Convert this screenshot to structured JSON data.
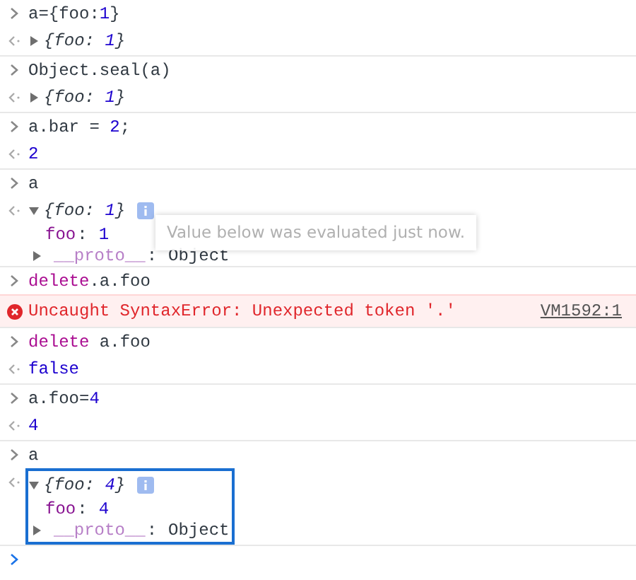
{
  "entries": [
    {
      "input": [
        {
          "text": "a={foo:",
          "kind": "plain"
        },
        {
          "text": "1",
          "kind": "number"
        },
        {
          "text": "}",
          "kind": "plain"
        }
      ],
      "output": {
        "kind": "object",
        "expanded": false,
        "info": false,
        "highlighted": false,
        "preview": [
          {
            "text": "{foo: ",
            "kind": "plain"
          },
          {
            "text": "1",
            "kind": "number"
          },
          {
            "text": "}",
            "kind": "plain"
          }
        ]
      }
    },
    {
      "input": [
        {
          "text": "Object.seal(a)",
          "kind": "plain"
        }
      ],
      "output": {
        "kind": "object",
        "expanded": false,
        "info": false,
        "highlighted": false,
        "preview": [
          {
            "text": "{foo: ",
            "kind": "plain"
          },
          {
            "text": "1",
            "kind": "number"
          },
          {
            "text": "}",
            "kind": "plain"
          }
        ]
      }
    },
    {
      "input": [
        {
          "text": "a.bar = ",
          "kind": "plain"
        },
        {
          "text": "2",
          "kind": "number"
        },
        {
          "text": ";",
          "kind": "plain"
        }
      ],
      "output": {
        "kind": "value",
        "text": "2"
      }
    },
    {
      "input": [
        {
          "text": "a",
          "kind": "plain"
        }
      ],
      "output": {
        "kind": "object",
        "expanded": true,
        "info": true,
        "highlighted": false,
        "tooltip": "Value below was evaluated just now.",
        "preview": [
          {
            "text": "{foo: ",
            "kind": "plain"
          },
          {
            "text": "1",
            "kind": "number"
          },
          {
            "text": "}",
            "kind": "plain"
          }
        ],
        "children": [
          {
            "key": "foo",
            "separator": ":",
            "value": "1",
            "kind": "own"
          },
          {
            "key": "__proto__",
            "separator": ":",
            "value": "Object",
            "kind": "inherited"
          }
        ]
      }
    },
    {
      "input": [
        {
          "text": "delete",
          "kind": "keyword"
        },
        {
          "text": ".a.foo",
          "kind": "plain"
        }
      ],
      "output": {
        "kind": "error",
        "text": "Uncaught SyntaxError: Unexpected token '.'",
        "source": "VM1592:1"
      }
    },
    {
      "input": [
        {
          "text": "delete",
          "kind": "keyword"
        },
        {
          "text": " a.foo",
          "kind": "plain"
        }
      ],
      "output": {
        "kind": "value",
        "text": "false"
      }
    },
    {
      "input": [
        {
          "text": "a.foo=",
          "kind": "plain"
        },
        {
          "text": "4",
          "kind": "number"
        }
      ],
      "output": {
        "kind": "value",
        "text": "4"
      }
    },
    {
      "input": [
        {
          "text": "a",
          "kind": "plain"
        }
      ],
      "output": {
        "kind": "object",
        "expanded": true,
        "info": true,
        "highlighted": true,
        "preview": [
          {
            "text": "{foo: ",
            "kind": "plain"
          },
          {
            "text": "4",
            "kind": "number"
          },
          {
            "text": "}",
            "kind": "plain"
          }
        ],
        "children": [
          {
            "key": "foo",
            "separator": ":",
            "value": "4",
            "kind": "own"
          },
          {
            "key": "__proto__",
            "separator": ":",
            "value": "Object",
            "kind": "inherited"
          }
        ]
      }
    }
  ]
}
